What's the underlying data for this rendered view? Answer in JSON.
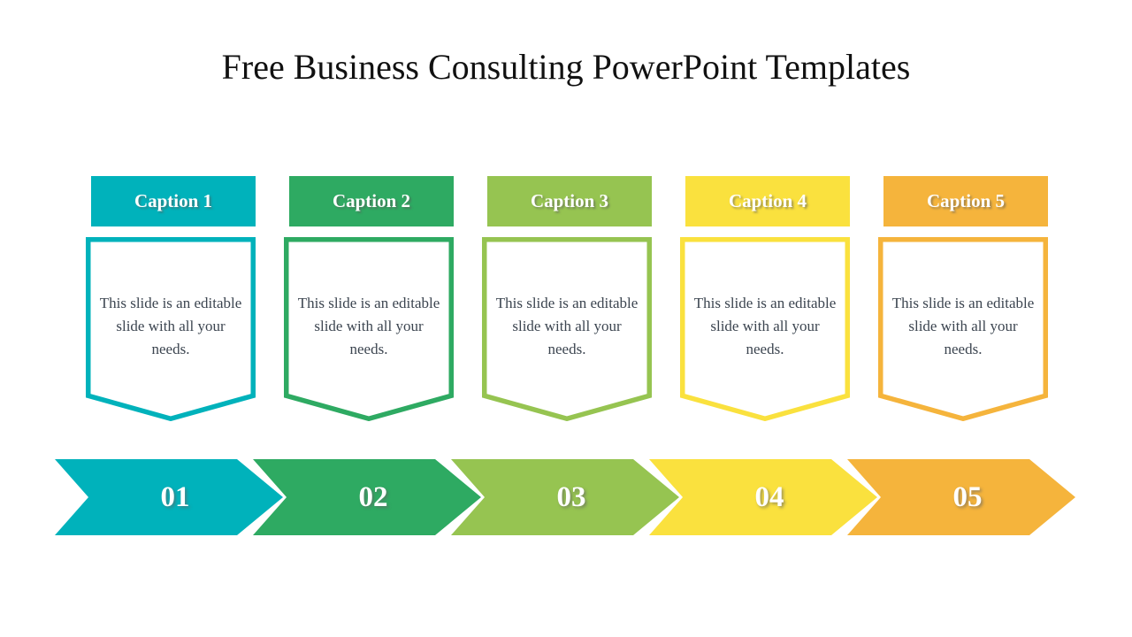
{
  "slide": {
    "title": "Free Business Consulting PowerPoint Templates",
    "background_color": "#ffffff",
    "title_color": "#111111",
    "body_text_color": "#3c4550"
  },
  "columns": [
    {
      "caption": "Caption 1",
      "body": "This slide is an editable slide with all your needs.",
      "number": "01",
      "color": "#00b2bb"
    },
    {
      "caption": "Caption 2",
      "body": "This slide is an editable slide with all your needs.",
      "number": "02",
      "color": "#2eaa62"
    },
    {
      "caption": "Caption 3",
      "body": "This slide is an editable slide with all your needs.",
      "number": "03",
      "color": "#96c451"
    },
    {
      "caption": "Caption 4",
      "body": "This slide is an editable slide with all your needs.",
      "number": "04",
      "color": "#fae13e"
    },
    {
      "caption": "Caption 5",
      "body": "This slide is an editable slide with all your needs.",
      "number": "05",
      "color": "#f5b43c"
    }
  ],
  "geometry": {
    "column_left_positions": [
      97,
      321,
      545,
      769,
      993
    ],
    "arrow_left_positions": [
      62,
      286,
      510,
      734,
      958
    ]
  }
}
